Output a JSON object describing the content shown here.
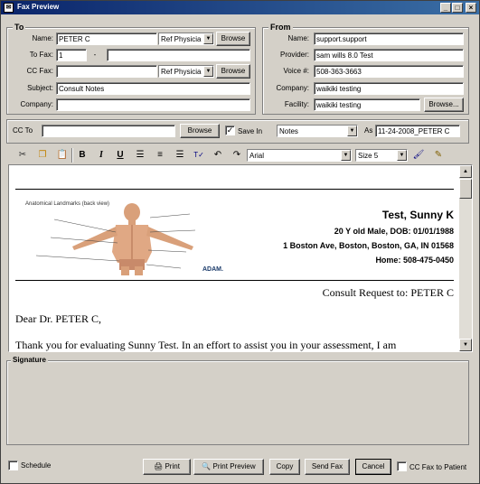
{
  "window": {
    "title": "Fax Preview"
  },
  "to": {
    "title": "To",
    "name_label": "Name:",
    "name_value": "PETER C",
    "name_type": "Ref Physicia",
    "browse_label": "Browse",
    "tofax_label": "To Fax:",
    "tofax_area": "1",
    "tofax_dash": "-",
    "tofax_number": "",
    "ccfax_label": "CC Fax:",
    "ccfax_value": "",
    "cc_type": "Ref Physicia",
    "cc_browse_label": "Browse",
    "subject_label": "Subject:",
    "subject_value": "Consult Notes",
    "company_label": "Company:",
    "company_value": ""
  },
  "from": {
    "title": "From",
    "name_label": "Name:",
    "name_value": "support.support",
    "provider_label": "Provider:",
    "provider_value": "sam wills 8.0 Test",
    "voice_label": "Voice #:",
    "voice_value": "508-363-3663",
    "company_label": "Company:",
    "company_value": "waikiki testing",
    "facility_label": "Facility:",
    "facility_value": "waikiki testing",
    "browse_label": "Browse..."
  },
  "cc": {
    "label": "CC To",
    "value": "",
    "browse_label": "Browse",
    "save_in_label": "Save In",
    "save_in_checked": true,
    "save_in_value": "Notes",
    "as_label": "As",
    "as_value": "11-24-2008_PETER C"
  },
  "editor_toolbar": {
    "font": "Arial",
    "size": "Size 5",
    "icons": [
      "cut-icon",
      "copy-icon",
      "paste-icon",
      "bold-icon",
      "italic-icon",
      "underline-icon",
      "align-left-icon",
      "align-center-icon",
      "align-right-icon",
      "spell-check-icon",
      "undo-icon",
      "redo-icon",
      "brush-icon",
      "edit-icon"
    ]
  },
  "document": {
    "patient_name": "Test, Sunny K",
    "patient_demo": "20 Y old Male, DOB: 01/01/1988",
    "patient_address": "1 Boston Ave, Boston, Boston, GA, IN 01568",
    "patient_phone": "Home: 508-475-0450",
    "image_caption": "Anatomical Landmarks (back view)",
    "image_brand": "ADAM.",
    "consult_request": "Consult Request to: PETER C",
    "greeting": "Dear Dr. PETER C,",
    "body": "Thank you for evaluating Sunny Test. In an effort to assist you in your assessment, I am"
  },
  "signature": {
    "title": "Signature"
  },
  "footer": {
    "schedule_label": "Schedule",
    "print_label": "Print",
    "print_preview_label": "Print Preview",
    "copy_label": "Copy",
    "send_fax_label": "Send Fax",
    "cancel_label": "Cancel",
    "cc_patient_label": "CC Fax to Patient"
  }
}
